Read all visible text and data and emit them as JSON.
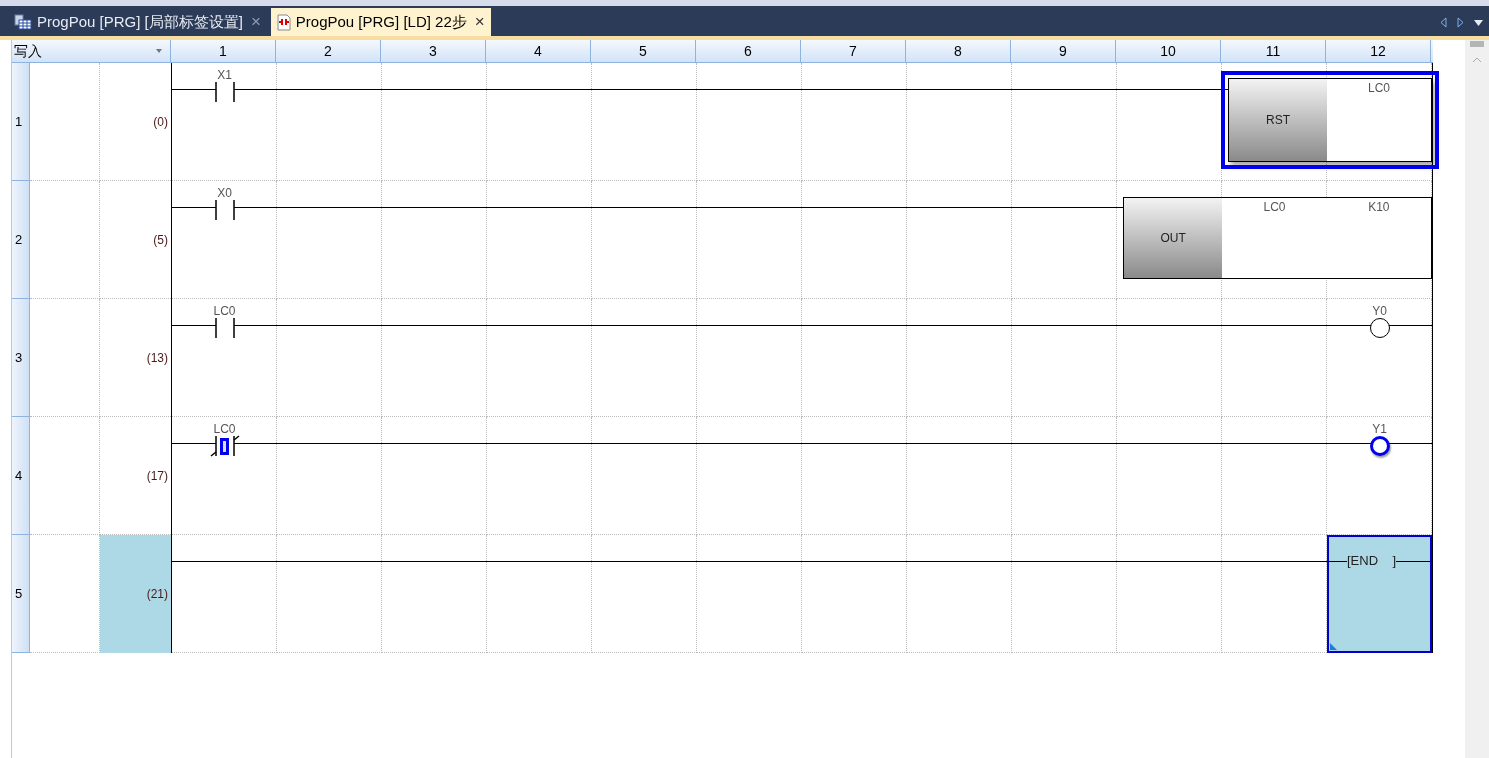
{
  "tabs": [
    {
      "label": "ProgPou [PRG] [局部标签设置]",
      "close": "×",
      "selected": false,
      "kind": "table"
    },
    {
      "label": "ProgPou [PRG] [LD] 22步",
      "close": "×",
      "selected": true,
      "kind": "ladder"
    }
  ],
  "mode": "写入",
  "columns": [
    "1",
    "2",
    "3",
    "4",
    "5",
    "6",
    "7",
    "8",
    "9",
    "10",
    "11",
    "12"
  ],
  "rungs": [
    {
      "row": "1",
      "step": "(0)",
      "selected": false,
      "elements": [
        {
          "kind": "contact",
          "label": "X1",
          "selected": false
        },
        {
          "kind": "instruction",
          "name": "RST",
          "operands": [
            "LC0"
          ],
          "selected": true
        }
      ]
    },
    {
      "row": "2",
      "step": "(5)",
      "selected": false,
      "elements": [
        {
          "kind": "contact",
          "label": "X0",
          "selected": false
        },
        {
          "kind": "instruction",
          "name": "OUT",
          "operands": [
            "LC0",
            "K10"
          ],
          "selected": false
        }
      ]
    },
    {
      "row": "3",
      "step": "(13)",
      "selected": false,
      "elements": [
        {
          "kind": "contact",
          "label": "LC0",
          "selected": false
        },
        {
          "kind": "coil",
          "label": "Y0",
          "selected": false
        }
      ]
    },
    {
      "row": "4",
      "step": "(17)",
      "selected": false,
      "elements": [
        {
          "kind": "contact",
          "label": "LC0",
          "selected": true
        },
        {
          "kind": "coil",
          "label": "Y1",
          "selected": true
        }
      ]
    },
    {
      "row": "5",
      "step": "(21)",
      "selected": true,
      "elements": [
        {
          "kind": "end",
          "label": "[END    ]",
          "selected": true
        }
      ]
    }
  ]
}
